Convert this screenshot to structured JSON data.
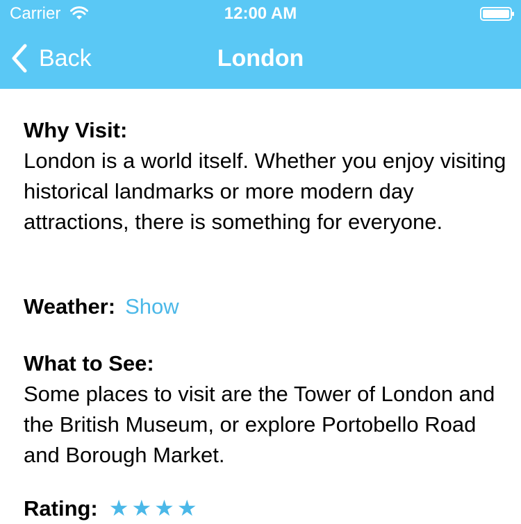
{
  "status_bar": {
    "carrier": "Carrier",
    "time": "12:00 AM"
  },
  "nav": {
    "back_label": "Back",
    "title": "London"
  },
  "content": {
    "why_visit_label": "Why Visit:",
    "why_visit_text": "London is a world itself. Whether you enjoy visiting historical landmarks or more modern day attractions, there is something for everyone.",
    "weather_label": "Weather:",
    "weather_link": "Show",
    "what_to_see_label": "What to See:",
    "what_to_see_text": "Some places to visit are the Tower of London and the British Museum, or explore Portobello Road and Borough Market.",
    "rating_label": "Rating:",
    "rating_stars": "★★★★"
  },
  "colors": {
    "header_bg": "#5AC8F5",
    "link": "#4BB8E8"
  }
}
